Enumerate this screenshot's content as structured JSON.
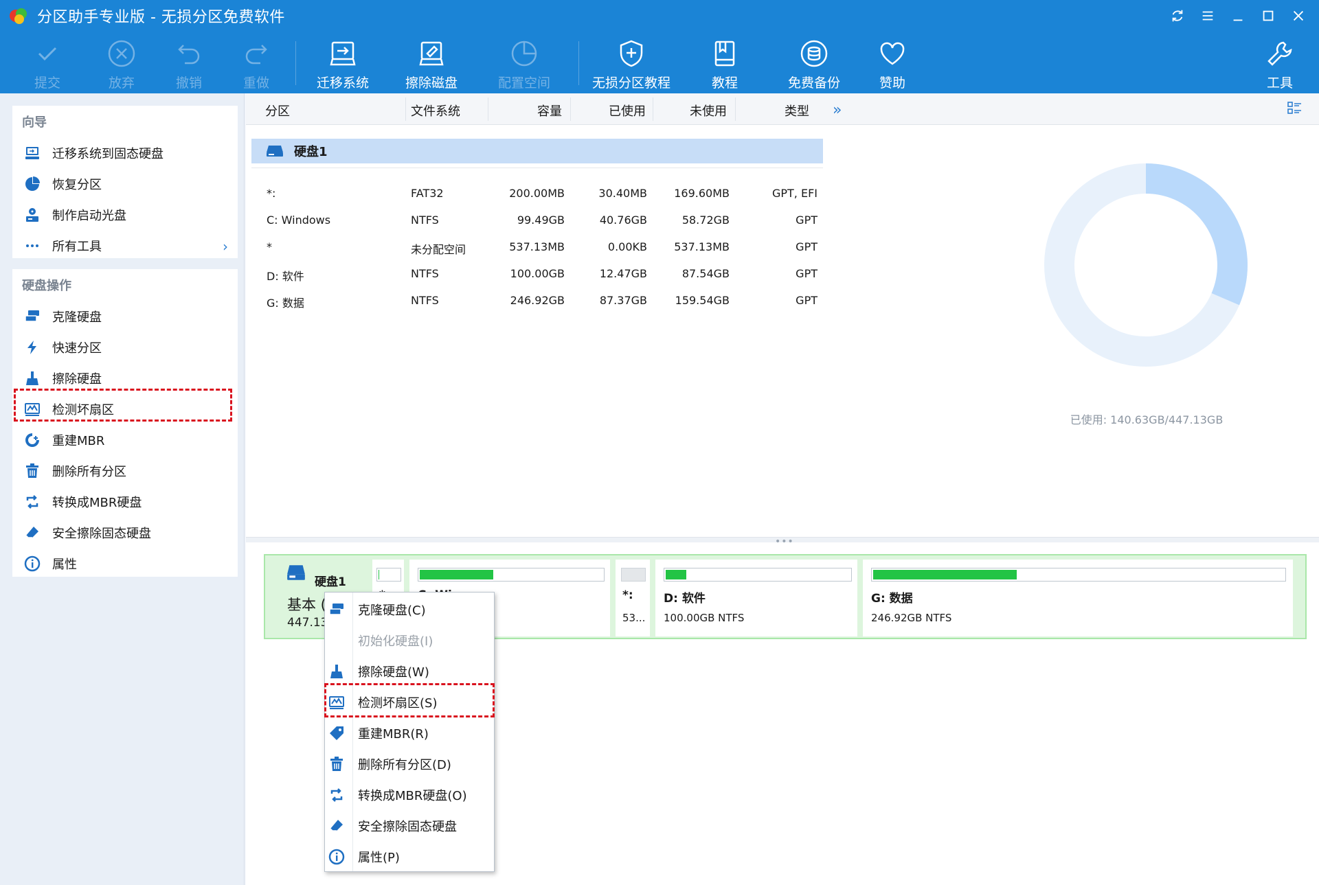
{
  "window": {
    "title": "分区助手专业版 - 无损分区免费软件"
  },
  "toolbar": {
    "items": [
      {
        "label": "提交",
        "icon": "check-icon",
        "disabled": true
      },
      {
        "label": "放弃",
        "icon": "discard-icon",
        "disabled": true
      },
      {
        "label": "撤销",
        "icon": "undo-icon",
        "disabled": true
      },
      {
        "label": "重做",
        "icon": "redo-icon",
        "disabled": true
      },
      {
        "label": "迁移系统",
        "icon": "migrate-os-icon",
        "disabled": false
      },
      {
        "label": "擦除磁盘",
        "icon": "wipe-disk-icon",
        "disabled": false
      },
      {
        "label": "配置空间",
        "icon": "allocate-space-icon",
        "disabled": true
      },
      {
        "label": "无损分区教程",
        "icon": "shield-plus-icon",
        "disabled": false
      },
      {
        "label": "教程",
        "icon": "book-icon",
        "disabled": false
      },
      {
        "label": "免费备份",
        "icon": "backup-icon",
        "disabled": false
      },
      {
        "label": "赞助",
        "icon": "heart-icon",
        "disabled": false
      },
      {
        "label": "工具",
        "icon": "wrench-icon",
        "disabled": false
      }
    ]
  },
  "wizard": {
    "title": "向导",
    "items": [
      {
        "label": "迁移系统到固态硬盘",
        "icon": "migrate-ssd-icon"
      },
      {
        "label": "恢复分区",
        "icon": "recover-partition-icon"
      },
      {
        "label": "制作启动光盘",
        "icon": "bootable-media-icon"
      },
      {
        "label": "所有工具",
        "icon": "more-dots-icon"
      }
    ]
  },
  "disk_ops": {
    "title": "硬盘操作",
    "items": [
      {
        "label": "克隆硬盘",
        "icon": "clone-disk-icon"
      },
      {
        "label": "快速分区",
        "icon": "lightning-icon"
      },
      {
        "label": "擦除硬盘",
        "icon": "wipe-brush-icon"
      },
      {
        "label": "检测坏扇区",
        "icon": "bad-sector-icon"
      },
      {
        "label": "重建MBR",
        "icon": "rebuild-mbr-icon"
      },
      {
        "label": "删除所有分区",
        "icon": "trash-icon"
      },
      {
        "label": "转换成MBR硬盘",
        "icon": "convert-icon"
      },
      {
        "label": "安全擦除固态硬盘",
        "icon": "eraser-icon"
      },
      {
        "label": "属性",
        "icon": "info-icon"
      }
    ]
  },
  "table": {
    "columns": [
      "分区",
      "文件系统",
      "容量",
      "已使用",
      "未使用",
      "类型"
    ],
    "disk_label": "硬盘1",
    "rows": [
      {
        "name": "*:",
        "fs": "FAT32",
        "capacity": "200.00MB",
        "used": "30.40MB",
        "free": "169.60MB",
        "type": "GPT, EFI"
      },
      {
        "name": "C: Windows",
        "fs": "NTFS",
        "capacity": "99.49GB",
        "used": "40.76GB",
        "free": "58.72GB",
        "type": "GPT"
      },
      {
        "name": "*",
        "fs": "未分配空间",
        "capacity": "537.13MB",
        "used": "0.00KB",
        "free": "537.13MB",
        "type": "GPT"
      },
      {
        "name": "D: 软件",
        "fs": "NTFS",
        "capacity": "100.00GB",
        "used": "12.47GB",
        "free": "87.54GB",
        "type": "GPT"
      },
      {
        "name": "G: 数据",
        "fs": "NTFS",
        "capacity": "246.92GB",
        "used": "87.37GB",
        "free": "159.54GB",
        "type": "GPT"
      }
    ]
  },
  "usage": {
    "legend": "已使用: 140.63GB/447.13GB",
    "used_fraction": 0.3145,
    "used_color": "#b9d9fb",
    "free_color": "#e8f1fb"
  },
  "diskmap": {
    "name": "硬盘1",
    "type": "基本 (",
    "size": "447.13",
    "parts": [
      {
        "label": "*",
        "info": "",
        "used_fraction": 0.15,
        "unallocated": false
      },
      {
        "label": "C: Wi...",
        "info": "",
        "used_fraction": 0.41,
        "unallocated": false
      },
      {
        "label": "*:",
        "info": "53...",
        "used_fraction": 0,
        "unallocated": true
      },
      {
        "label": "D: 软件",
        "info": "100.00GB NTFS",
        "used_fraction": 0.125,
        "unallocated": false
      },
      {
        "label": "G: 数据",
        "info": "246.92GB NTFS",
        "used_fraction": 0.354,
        "unallocated": false
      }
    ]
  },
  "context_menu": {
    "items": [
      {
        "label": "克隆硬盘(C)",
        "icon": "clone-disk-icon",
        "disabled": false
      },
      {
        "label": "初始化硬盘(I)",
        "icon": "",
        "disabled": true
      },
      {
        "label": "擦除硬盘(W)",
        "icon": "wipe-brush-icon",
        "disabled": false
      },
      {
        "label": "检测坏扇区(S)",
        "icon": "bad-sector-icon",
        "disabled": false
      },
      {
        "label": "重建MBR(R)",
        "icon": "tag-icon",
        "disabled": false
      },
      {
        "label": "删除所有分区(D)",
        "icon": "trash-icon",
        "disabled": false
      },
      {
        "label": "转换成MBR硬盘(O)",
        "icon": "convert-icon",
        "disabled": false
      },
      {
        "label": "安全擦除固态硬盘",
        "icon": "eraser-icon",
        "disabled": false
      },
      {
        "label": "属性(P)",
        "icon": "info-icon",
        "disabled": false
      }
    ]
  },
  "colors": {
    "brand_blue": "#1b84d6",
    "icon_blue": "#1f6fc2",
    "highlight_red": "#d9121e",
    "used_green": "#23c445"
  }
}
